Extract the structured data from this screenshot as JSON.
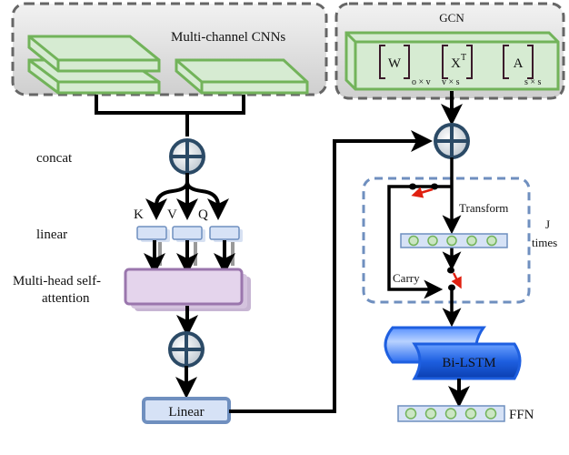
{
  "left_panel": {
    "title": "Multi-channel CNNs",
    "side_labels": {
      "concat": "concat",
      "linear": "linear",
      "attention_line1": "Multi-head self-",
      "attention_line2": "attention"
    },
    "branch_labels": [
      "K",
      "V",
      "Q"
    ],
    "linear_box": "Linear"
  },
  "right_panel": {
    "title": "GCN",
    "matrices": [
      {
        "symbol": "W",
        "sup": "",
        "dims": "o × v"
      },
      {
        "symbol": "X",
        "sup": "T",
        "dims": "v × s"
      },
      {
        "symbol": "A",
        "sup": "",
        "dims": "s × s"
      }
    ],
    "highway": {
      "transform": "Transform",
      "carry": "Carry",
      "repeat_line1": "J",
      "repeat_line2": "times"
    },
    "bilstm": "Bi-LSTM",
    "ffn": "FFN"
  },
  "colors": {
    "green_fill": "#d6ebd2",
    "green_stroke": "#72b35a",
    "panel_fill": "#e6e6e6",
    "panel_stroke": "#666666",
    "blue_dash": "#6f8fbf",
    "linear_fill": "#d6e2f6",
    "attention_fill": "#e4d4ec",
    "attention_stroke": "#9a76ad",
    "bilstm_blue": "#1e5fe0",
    "red": "#e02010",
    "oplus": "#2b4a66"
  }
}
